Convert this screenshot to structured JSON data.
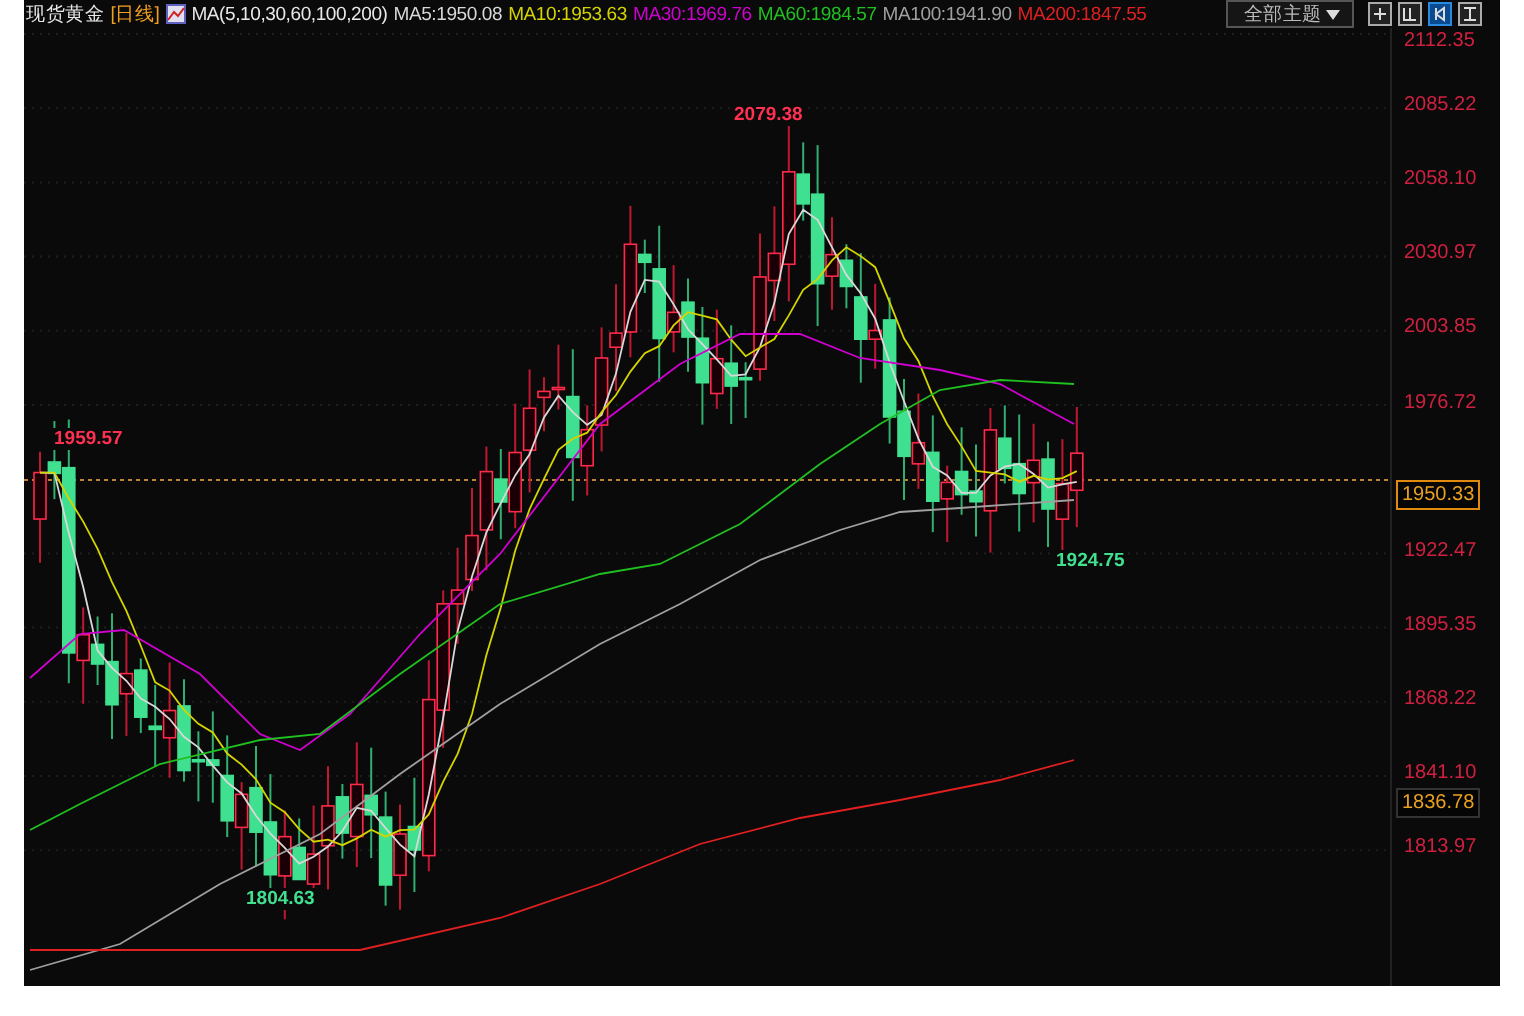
{
  "header": {
    "symbol": "现货黄金",
    "period": "[日线]",
    "indicator": "MA(5,10,30,60,100,200)",
    "averages": [
      {
        "label": "MA5:1950.08",
        "color": "#d8d8d8"
      },
      {
        "label": "MA10:1953.63",
        "color": "#d4d400"
      },
      {
        "label": "MA30:1969.76",
        "color": "#d000d0"
      },
      {
        "label": "MA60:1984.57",
        "color": "#20c020"
      },
      {
        "label": "MA100:1941.90",
        "color": "#a0a0a0"
      },
      {
        "label": "MA200:1847.55",
        "color": "#e02020"
      }
    ]
  },
  "theme_select": {
    "label": "全部主题"
  },
  "toolbar": [
    {
      "selected": false
    },
    {
      "selected": false
    },
    {
      "selected": true
    },
    {
      "selected": false
    }
  ],
  "axis": {
    "ticks": [
      "2112.35",
      "2085.22",
      "2058.10",
      "2030.97",
      "2003.85",
      "1976.72",
      "1922.47",
      "1895.35",
      "1868.22",
      "1841.10",
      "1813.97"
    ]
  },
  "price_tags": [
    {
      "value": "1950.33",
      "kind": "last"
    },
    {
      "value": "1836.78",
      "kind": "ma"
    }
  ],
  "annotations": [
    {
      "text": "1959.57",
      "kind": "high"
    },
    {
      "text": "2079.38",
      "kind": "high"
    },
    {
      "text": "1804.63",
      "kind": "low"
    },
    {
      "text": "1924.75",
      "kind": "low"
    }
  ]
}
